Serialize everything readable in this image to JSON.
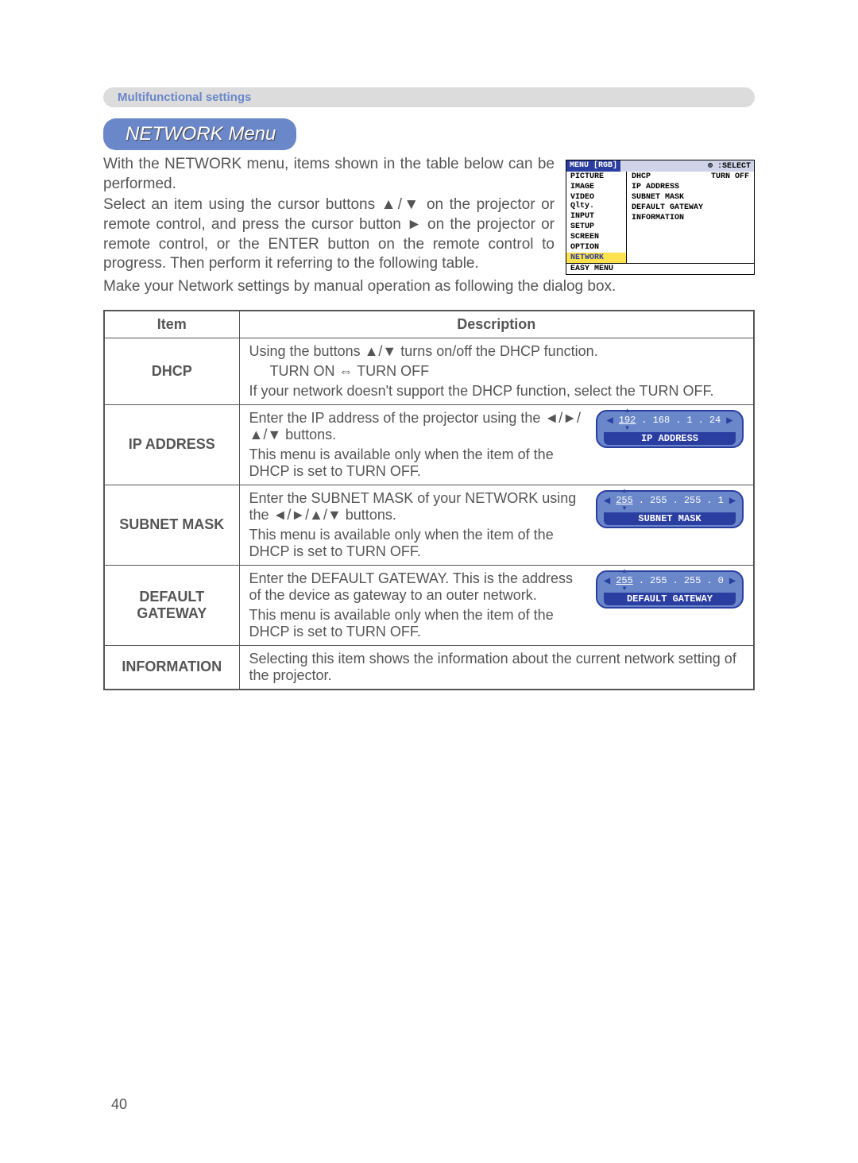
{
  "section_bar": "Multifunctional settings",
  "title": "NETWORK Menu",
  "intro1": "With the NETWORK menu, items shown in the table below can be performed.",
  "intro2": "Select an item using the cursor buttons ▲/▼ on the projector or remote control, and press the cursor button ► on the projector or remote control, or the ENTER button on the remote control to progress. Then perform it referring to the following table.",
  "intro3": "Make your Network settings by manual operation as following the dialog box.",
  "osd": {
    "header_left": "MENU [RGB]",
    "header_right": "⊕ :SELECT",
    "left_items": [
      "PICTURE",
      "IMAGE",
      "VIDEO Qlty.",
      "INPUT",
      "SETUP",
      "SCREEN",
      "OPTION",
      "NETWORK"
    ],
    "left_highlight_index": 7,
    "right_items": [
      {
        "label": "DHCP",
        "value": "TURN OFF"
      },
      {
        "label": "IP ADDRESS",
        "value": ""
      },
      {
        "label": "SUBNET MASK",
        "value": ""
      },
      {
        "label": "DEFAULT GATEWAY",
        "value": ""
      },
      {
        "label": "INFORMATION",
        "value": ""
      }
    ],
    "bottom": "EASY MENU"
  },
  "table": {
    "headers": {
      "item": "Item",
      "description": "Description"
    },
    "rows": [
      {
        "item": "DHCP",
        "p1": "Using the buttons ▲/▼ turns on/off the DHCP function.",
        "p2": "TURN ON ⇔ TURN OFF",
        "p3": "If your network doesn't support the DHCP function, select the TURN OFF."
      },
      {
        "item": "IP ADDRESS",
        "p1": "Enter the IP address of the projector  using the ◄/►/▲/▼ buttons.",
        "p3": "This menu is available only when the item of the DHCP is set to TURN OFF.",
        "mini": {
          "octets": [
            "192",
            "168",
            "1",
            "24"
          ],
          "label": "IP ADDRESS"
        }
      },
      {
        "item": "SUBNET MASK",
        "p1": "Enter the SUBNET MASK  of your NETWORK using the ◄/►/▲/▼ buttons.",
        "p3": "This menu is available only when the item of the DHCP is set to TURN OFF.",
        "mini": {
          "octets": [
            "255",
            "255",
            "255",
            "1"
          ],
          "label": "SUBNET MASK"
        }
      },
      {
        "item": "DEFAULT GATEWAY",
        "p1": "Enter the DEFAULT GATEWAY. This is the address of the device as gateway to an outer network.",
        "p3": "This menu is available only when the item of the DHCP is set to TURN OFF.",
        "mini": {
          "octets": [
            "255",
            "255",
            "255",
            "0"
          ],
          "label": "DEFAULT GATEWAY"
        }
      },
      {
        "item": "INFORMATION",
        "p1": "Selecting this item shows the information about the current network setting of the projector."
      }
    ]
  },
  "page_number": "40"
}
